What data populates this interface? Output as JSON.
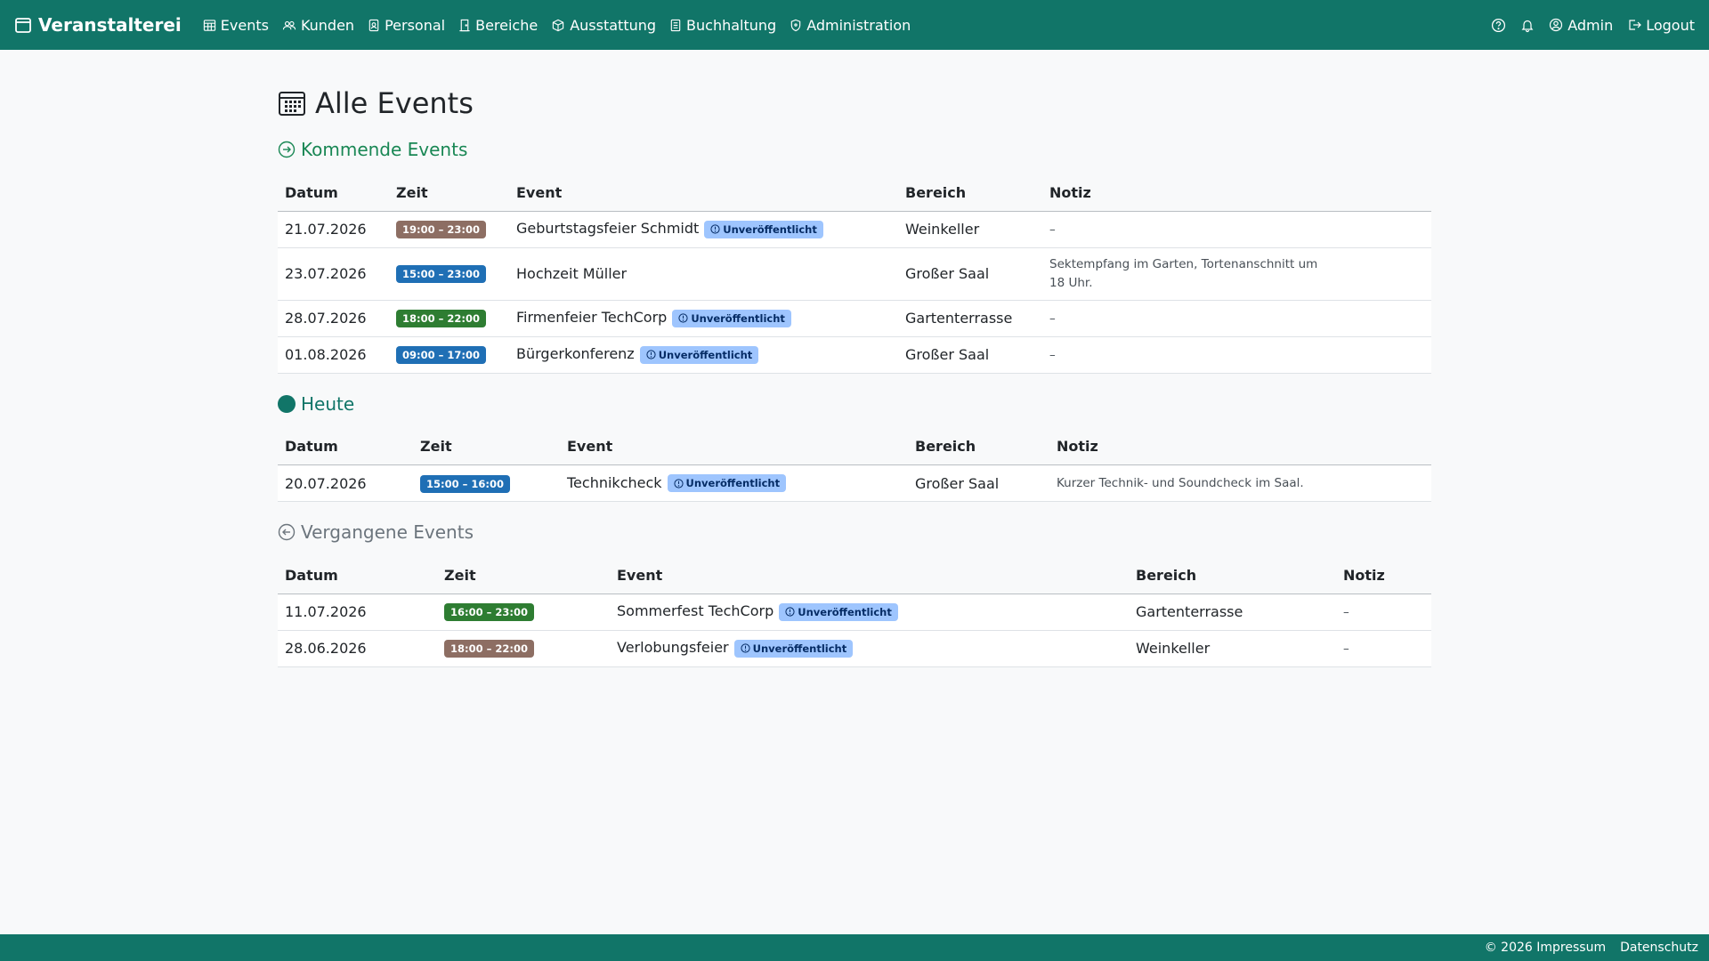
{
  "colors": {
    "primary": "#117568",
    "upcoming": "#198754",
    "badge_brown": "#8d6e63",
    "badge_blue": "#1f6fb5",
    "badge_green": "#2e7d32",
    "badge_info": "#9ec5fe"
  },
  "navbar": {
    "brand": "Veranstalterei",
    "items": [
      {
        "label": "Events",
        "icon": "calendar-table-icon"
      },
      {
        "label": "Kunden",
        "icon": "people-icon"
      },
      {
        "label": "Personal",
        "icon": "badge-icon"
      },
      {
        "label": "Bereiche",
        "icon": "door-icon"
      },
      {
        "label": "Ausstattung",
        "icon": "box-icon"
      },
      {
        "label": "Buchhaltung",
        "icon": "ledger-icon"
      },
      {
        "label": "Administration",
        "icon": "shield-icon"
      }
    ],
    "right": {
      "user": "Admin",
      "logout": "Logout"
    }
  },
  "page": {
    "title": "Alle Events"
  },
  "sections": {
    "upcoming": {
      "title": "Kommende Events",
      "headers": [
        "Datum",
        "Zeit",
        "Event",
        "Bereich",
        "Notiz"
      ],
      "rows": [
        {
          "date": "21.07.2026",
          "time": "19:00 – 23:00",
          "color": "brown",
          "event": "Geburtstagsfeier Schmidt",
          "badge": "Unveröffentlicht",
          "area": "Weinkeller",
          "note": "–"
        },
        {
          "date": "23.07.2026",
          "time": "15:00 – 23:00",
          "color": "blue",
          "event": "Hochzeit Müller",
          "badge": "",
          "area": "Großer Saal",
          "note": "Sektempfang im Garten, Tortenanschnitt um 18 Uhr."
        },
        {
          "date": "28.07.2026",
          "time": "18:00 – 22:00",
          "color": "green",
          "event": "Firmenfeier TechCorp",
          "badge": "Unveröffentlicht",
          "area": "Gartenterrasse",
          "note": "–"
        },
        {
          "date": "01.08.2026",
          "time": "09:00 – 17:00",
          "color": "blue",
          "event": "Bürgerkonferenz",
          "badge": "Unveröffentlicht",
          "area": "Großer Saal",
          "note": "–"
        }
      ]
    },
    "today": {
      "title": "Heute",
      "headers": [
        "Datum",
        "Zeit",
        "Event",
        "Bereich",
        "Notiz"
      ],
      "rows": [
        {
          "date": "20.07.2026",
          "time": "15:00 – 16:00",
          "color": "blue",
          "event": "Technikcheck",
          "badge": "Unveröffentlicht",
          "area": "Großer Saal",
          "note": "Kurzer Technik- und Soundcheck im Saal."
        }
      ]
    },
    "past": {
      "title": "Vergangene Events",
      "headers": [
        "Datum",
        "Zeit",
        "Event",
        "Bereich",
        "Notiz"
      ],
      "rows": [
        {
          "date": "11.07.2026",
          "time": "16:00 – 23:00",
          "color": "green",
          "event": "Sommerfest TechCorp",
          "badge": "Unveröffentlicht",
          "area": "Gartenterrasse",
          "note": "–"
        },
        {
          "date": "28.06.2026",
          "time": "18:00 – 22:00",
          "color": "brown",
          "event": "Verlobungsfeier",
          "badge": "Unveröffentlicht",
          "area": "Weinkeller",
          "note": "–"
        }
      ]
    }
  },
  "footer": {
    "impressum": "© 2026 Impressum",
    "datenschutz": "Datenschutz"
  }
}
